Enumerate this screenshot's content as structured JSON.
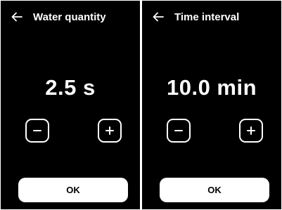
{
  "screens": [
    {
      "title": "Water quantity",
      "value": "2.5 s",
      "ok_label": "OK",
      "back_icon": "arrow-left-icon",
      "minus_icon": "minus-icon",
      "plus_icon": "plus-icon"
    },
    {
      "title": "Time interval",
      "value": "10.0 min",
      "ok_label": "OK",
      "back_icon": "arrow-left-icon",
      "minus_icon": "minus-icon",
      "plus_icon": "plus-icon"
    }
  ],
  "colors": {
    "screen_bg": "#000000",
    "foreground": "#ffffff",
    "ok_button_bg": "#ffffff",
    "ok_button_text": "#000000"
  }
}
